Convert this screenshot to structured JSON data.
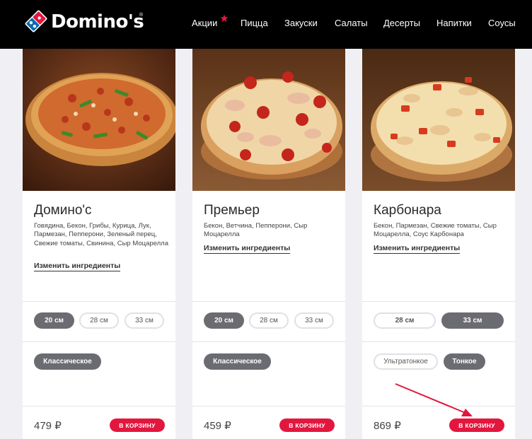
{
  "brand": {
    "name": "Domino's",
    "registered": "®"
  },
  "nav": [
    {
      "label": "Акции"
    },
    {
      "label": "Пицца"
    },
    {
      "label": "Закуски"
    },
    {
      "label": "Салаты"
    },
    {
      "label": "Десерты"
    },
    {
      "label": "Напитки"
    },
    {
      "label": "Соусы"
    }
  ],
  "colors": {
    "header": "#000000",
    "accent_red": "#e3173e",
    "pill_active": "#6b6b72",
    "brand_blue": "#0a6bb0"
  },
  "cards": [
    {
      "title": "Домино'с",
      "description": "Говядина, Бекон, Грибы, Курица, Лук, Пармезан, Пепперони, Зеленый перец, Свежие томаты, Свинина, Сыр Моцарелла",
      "edit_label": "Изменить ингредиенты",
      "sizes": [
        {
          "label": "20 см",
          "active": true
        },
        {
          "label": "28 см",
          "active": false
        },
        {
          "label": "33 см",
          "active": false
        }
      ],
      "crusts": [
        {
          "label": "Классическое",
          "active": true
        }
      ],
      "price": "479 ₽",
      "cart_label": "В КОРЗИНУ"
    },
    {
      "title": "Премьер",
      "description": "Бекон, Ветчина, Пепперони, Сыр Моцарелла",
      "edit_label": "Изменить ингредиенты",
      "sizes": [
        {
          "label": "20 см",
          "active": true
        },
        {
          "label": "28 см",
          "active": false
        },
        {
          "label": "33 см",
          "active": false
        }
      ],
      "crusts": [
        {
          "label": "Классическое",
          "active": true
        }
      ],
      "price": "459 ₽",
      "cart_label": "В КОРЗИНУ"
    },
    {
      "title": "Карбонара",
      "description": "Бекон, Пармезан, Свежие томаты, Сыр Моцарелла, Соус Карбонара",
      "edit_label": "Изменить ингредиенты",
      "sizes": [
        {
          "label": "28 см",
          "active": false
        },
        {
          "label": "33 см",
          "active": true
        }
      ],
      "crusts": [
        {
          "label": "Ультратонкое",
          "active": false
        },
        {
          "label": "Тонкое",
          "active": true
        }
      ],
      "price": "869 ₽",
      "cart_label": "В КОРЗИНУ"
    }
  ]
}
